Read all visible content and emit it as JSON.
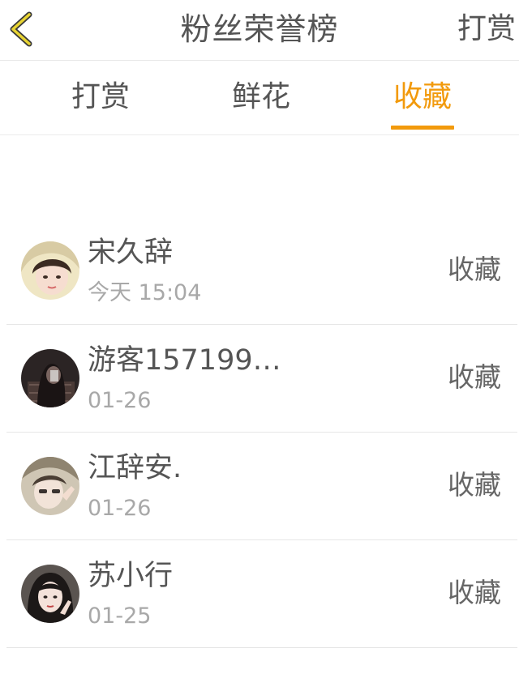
{
  "header": {
    "title": "粉丝荣誉榜",
    "right_button": "打赏",
    "back_icon": "chevron-left-icon",
    "back_icon_color": "#e0c82e"
  },
  "tabs": [
    {
      "label": "打赏",
      "active": false
    },
    {
      "label": "鲜花",
      "active": false
    },
    {
      "label": "收藏",
      "active": true
    }
  ],
  "accent_color": "#f29a0c",
  "list": [
    {
      "name": "宋久辞",
      "time": "今天 15:04",
      "action": "收藏"
    },
    {
      "name": "游客157199…",
      "time": "01-26",
      "action": "收藏"
    },
    {
      "name": "江辞安.",
      "time": "01-26",
      "action": "收藏"
    },
    {
      "name": "苏小行",
      "time": "01-25",
      "action": "收藏"
    }
  ]
}
